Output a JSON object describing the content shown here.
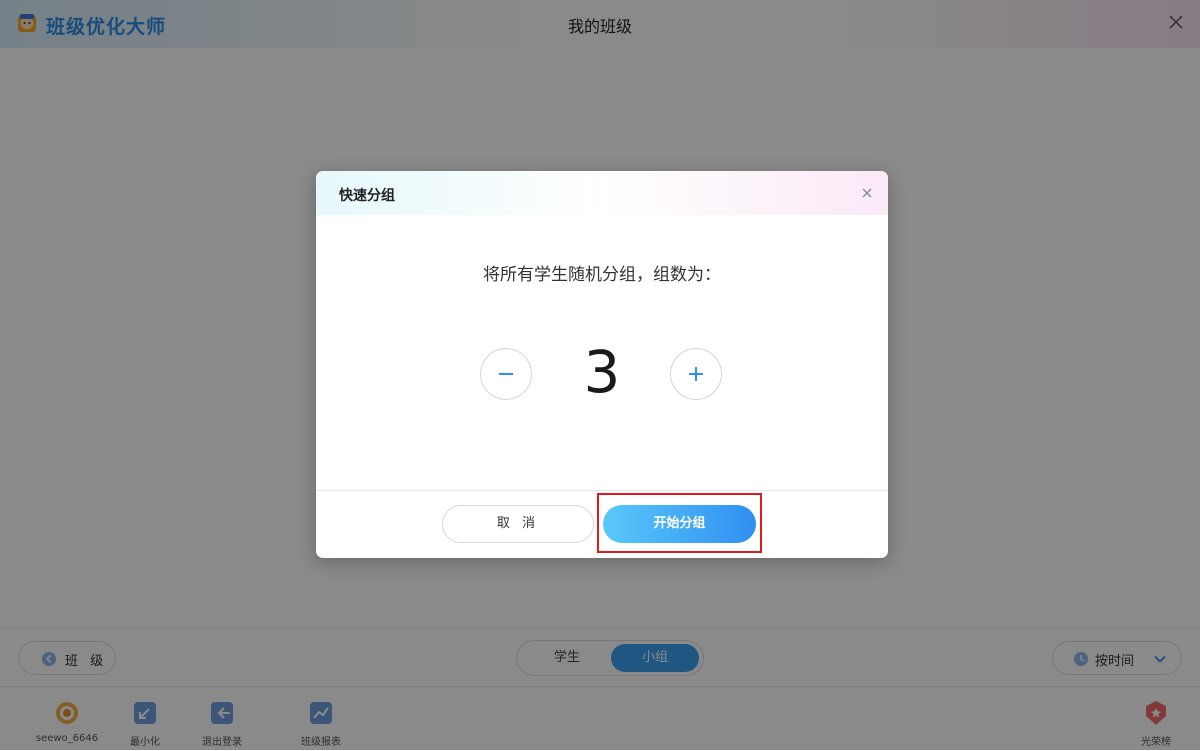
{
  "window": {
    "app_name": "班级优化大师",
    "title": "我的班级",
    "logo_icon": "app-logo-icon",
    "close_icon": "close-icon"
  },
  "toolbar": {
    "class_button_label": "班 级",
    "segment": {
      "options": [
        "学生",
        "小组"
      ],
      "selected": "小组"
    },
    "sort_label": "按时间"
  },
  "bottom_bar": {
    "user": "seewo_6646",
    "minimize": "最小化",
    "logout": "退出登录",
    "report": "班级报表",
    "honor": "光荣榜"
  },
  "dialog": {
    "title": "快速分组",
    "prompt": "将所有学生随机分组，组数为：",
    "group_count": "3",
    "cancel_label": "取 消",
    "start_label": "开始分组"
  },
  "colors": {
    "accent": "#3aa0f0",
    "highlight": "#e01b1b"
  }
}
